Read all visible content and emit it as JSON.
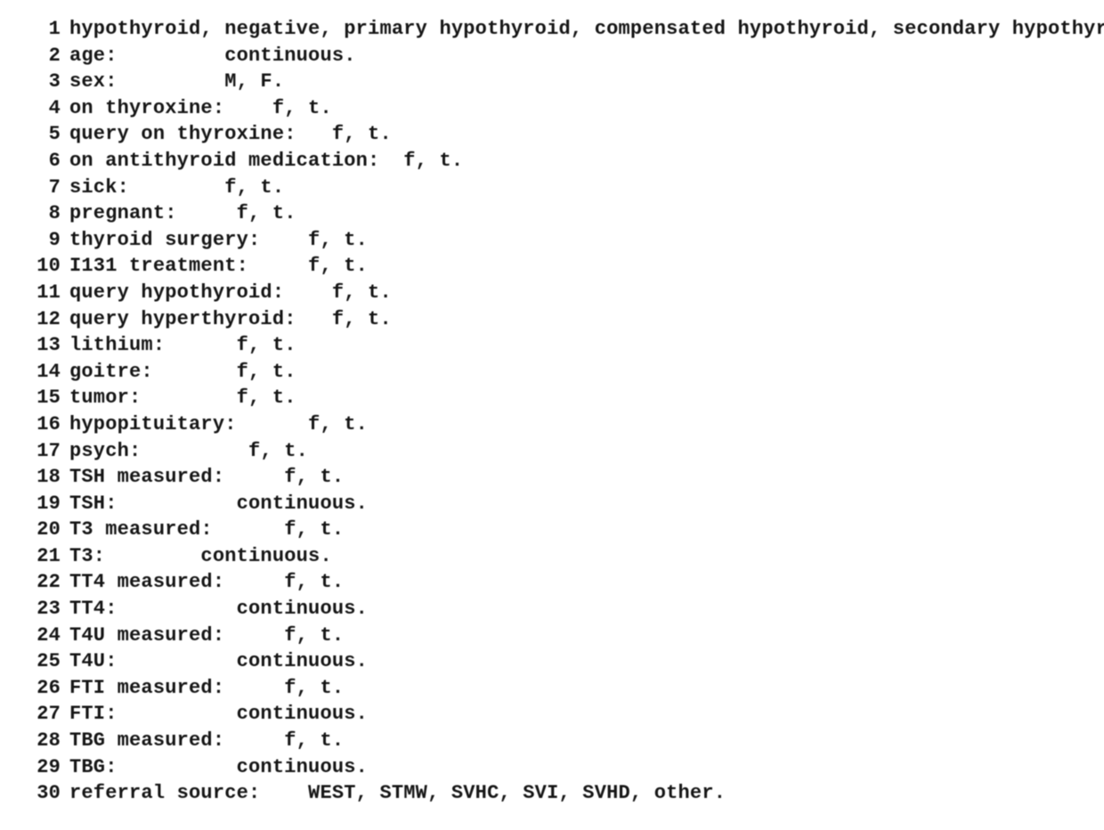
{
  "lines": [
    {
      "n": "1",
      "text": "hypothyroid, negative, primary hypothyroid, compensated hypothyroid, secondary hypothyroid."
    },
    {
      "n": "2",
      "text": "age:         continuous."
    },
    {
      "n": "3",
      "text": "sex:         M, F."
    },
    {
      "n": "4",
      "text": "on thyroxine:    f, t."
    },
    {
      "n": "5",
      "text": "query on thyroxine:   f, t."
    },
    {
      "n": "6",
      "text": "on antithyroid medication:  f, t."
    },
    {
      "n": "7",
      "text": "sick:        f, t."
    },
    {
      "n": "8",
      "text": "pregnant:     f, t."
    },
    {
      "n": "9",
      "text": "thyroid surgery:    f, t."
    },
    {
      "n": "10",
      "text": "I131 treatment:     f, t."
    },
    {
      "n": "11",
      "text": "query hypothyroid:    f, t."
    },
    {
      "n": "12",
      "text": "query hyperthyroid:   f, t."
    },
    {
      "n": "13",
      "text": "lithium:      f, t."
    },
    {
      "n": "14",
      "text": "goitre:       f, t."
    },
    {
      "n": "15",
      "text": "tumor:        f, t."
    },
    {
      "n": "16",
      "text": "hypopituitary:      f, t."
    },
    {
      "n": "17",
      "text": "psych:         f, t."
    },
    {
      "n": "18",
      "text": "TSH measured:     f, t."
    },
    {
      "n": "19",
      "text": "TSH:          continuous."
    },
    {
      "n": "20",
      "text": "T3 measured:      f, t."
    },
    {
      "n": "21",
      "text": "T3:        continuous."
    },
    {
      "n": "22",
      "text": "TT4 measured:     f, t."
    },
    {
      "n": "23",
      "text": "TT4:          continuous."
    },
    {
      "n": "24",
      "text": "T4U measured:     f, t."
    },
    {
      "n": "25",
      "text": "T4U:          continuous."
    },
    {
      "n": "26",
      "text": "FTI measured:     f, t."
    },
    {
      "n": "27",
      "text": "FTI:          continuous."
    },
    {
      "n": "28",
      "text": "TBG measured:     f, t."
    },
    {
      "n": "29",
      "text": "TBG:          continuous."
    },
    {
      "n": "30",
      "text": "referral source:    WEST, STMW, SVHC, SVI, SVHD, other."
    }
  ]
}
